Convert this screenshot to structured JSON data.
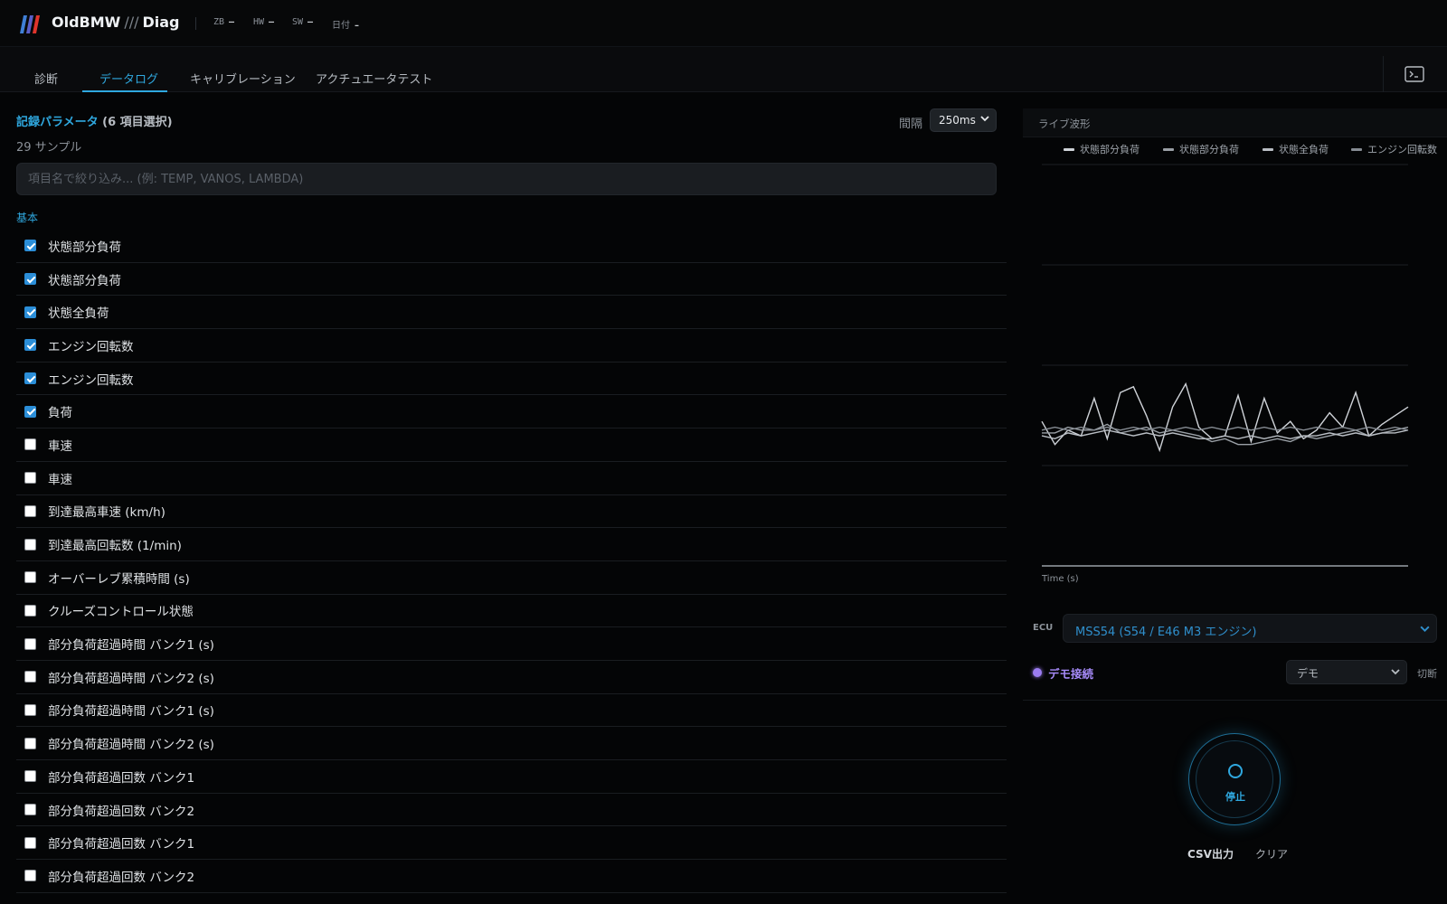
{
  "header": {
    "brand": "OldBMW",
    "slashes": "///",
    "suffix": "Diag",
    "stats": [
      {
        "key": "ZB",
        "value": "–"
      },
      {
        "key": "HW",
        "value": "–"
      },
      {
        "key": "SW",
        "value": "–"
      },
      {
        "key": "日付",
        "value": "–"
      }
    ],
    "logo_colors": [
      "#3f7fd6",
      "#5a5fc8",
      "#e0342c"
    ],
    "terminal_icon": "terminal-icon"
  },
  "tabs": [
    {
      "label": "診断",
      "active": false
    },
    {
      "label": "データログ",
      "active": true
    },
    {
      "label": "キャリブレーション",
      "active": false
    },
    {
      "label": "アクチュエータテスト",
      "active": false
    }
  ],
  "params": {
    "title": "記録パラメータ",
    "selected_text": "(6 項目選択)",
    "samples_text": "29 サンプル",
    "interval_label": "間隔",
    "interval_value": "250ms",
    "filter_placeholder": "項目名で絞り込み... (例: TEMP, VANOS, LAMBDA)",
    "filter_value": "",
    "group_label": "基本",
    "items": [
      {
        "label": "状態部分負荷",
        "checked": true
      },
      {
        "label": "状態部分負荷",
        "checked": true
      },
      {
        "label": "状態全負荷",
        "checked": true
      },
      {
        "label": "エンジン回転数",
        "checked": true
      },
      {
        "label": "エンジン回転数",
        "checked": true
      },
      {
        "label": "負荷",
        "checked": true
      },
      {
        "label": "車速",
        "checked": false
      },
      {
        "label": "車速",
        "checked": false
      },
      {
        "label": "到達最高車速 (km/h)",
        "checked": false
      },
      {
        "label": "到達最高回転数 (1/min)",
        "checked": false
      },
      {
        "label": "オーバーレブ累積時間 (s)",
        "checked": false
      },
      {
        "label": "クルーズコントロール状態",
        "checked": false
      },
      {
        "label": "部分負荷超過時間 バンク1 (s)",
        "checked": false
      },
      {
        "label": "部分負荷超過時間 バンク2 (s)",
        "checked": false
      },
      {
        "label": "部分負荷超過時間 バンク1 (s)",
        "checked": false
      },
      {
        "label": "部分負荷超過時間 バンク2 (s)",
        "checked": false
      },
      {
        "label": "部分負荷超過回数 バンク1",
        "checked": false
      },
      {
        "label": "部分負荷超過回数 バンク2",
        "checked": false
      },
      {
        "label": "部分負荷超過回数 バンク1",
        "checked": false
      },
      {
        "label": "部分負荷超過回数 バンク2",
        "checked": false
      }
    ]
  },
  "wave": {
    "title": "ライブ波形",
    "legend": [
      {
        "name": "状態部分負荷",
        "color": "#cfd3d8"
      },
      {
        "name": "状態部分負荷",
        "color": "#9aa0a6"
      },
      {
        "name": "状態全負荷",
        "color": "#b9bec4"
      },
      {
        "name": "エンジン回転数",
        "color": "#868c93"
      }
    ],
    "xlabel": "Time (s)"
  },
  "chart_data": {
    "type": "line",
    "title": "",
    "xlabel": "Time (s)",
    "ylabel": "",
    "grid": true,
    "legend_placement": "top",
    "x": [
      1,
      2,
      3,
      4,
      5,
      6,
      7,
      8,
      9,
      10,
      11,
      12,
      13,
      14,
      15,
      16,
      17,
      18,
      19,
      20,
      21,
      22,
      23,
      24,
      25,
      26,
      27,
      28,
      29
    ],
    "series": [
      {
        "name": "状態部分負荷",
        "values": [
          0.5,
          0.42,
          0.47,
          0.45,
          0.58,
          0.44,
          0.6,
          0.62,
          0.52,
          0.4,
          0.55,
          0.63,
          0.48,
          0.44,
          0.45,
          0.59,
          0.43,
          0.58,
          0.46,
          0.5,
          0.44,
          0.47,
          0.53,
          0.48,
          0.6,
          0.45,
          0.49,
          0.52,
          0.55
        ]
      },
      {
        "name": "状態部分負荷",
        "values": [
          0.46,
          0.46,
          0.48,
          0.47,
          0.47,
          0.49,
          0.46,
          0.47,
          0.48,
          0.46,
          0.47,
          0.46,
          0.45,
          0.43,
          0.44,
          0.42,
          0.42,
          0.43,
          0.44,
          0.43,
          0.45,
          0.44,
          0.45,
          0.46,
          0.47,
          0.45,
          0.46,
          0.47,
          0.48
        ]
      },
      {
        "name": "状態全負荷",
        "values": [
          0.45,
          0.44,
          0.46,
          0.45,
          0.46,
          0.47,
          0.46,
          0.45,
          0.46,
          0.45,
          0.46,
          0.45,
          0.44,
          0.44,
          0.45,
          0.44,
          0.45,
          0.44,
          0.45,
          0.44,
          0.45,
          0.45,
          0.46,
          0.45,
          0.46,
          0.45,
          0.46,
          0.46,
          0.47
        ]
      },
      {
        "name": "エンジン回転数",
        "values": [
          0.47,
          0.48,
          0.47,
          0.48,
          0.47,
          0.48,
          0.47,
          0.48,
          0.47,
          0.48,
          0.47,
          0.48,
          0.47,
          0.48,
          0.47,
          0.48,
          0.47,
          0.48,
          0.47,
          0.48,
          0.47,
          0.48,
          0.47,
          0.48,
          0.47,
          0.48,
          0.47,
          0.48,
          0.47
        ]
      }
    ]
  },
  "ecu": {
    "label": "ECU",
    "value": "MSS54 (S54 / E46 M3 エンジン)"
  },
  "connection": {
    "status": "デモ接続",
    "mode": "デモ",
    "disconnect": "切断",
    "status_color": "#a78bfa"
  },
  "controls": {
    "stop_label": "停止",
    "csv_label": "CSV出力",
    "clear_label": "クリア"
  }
}
